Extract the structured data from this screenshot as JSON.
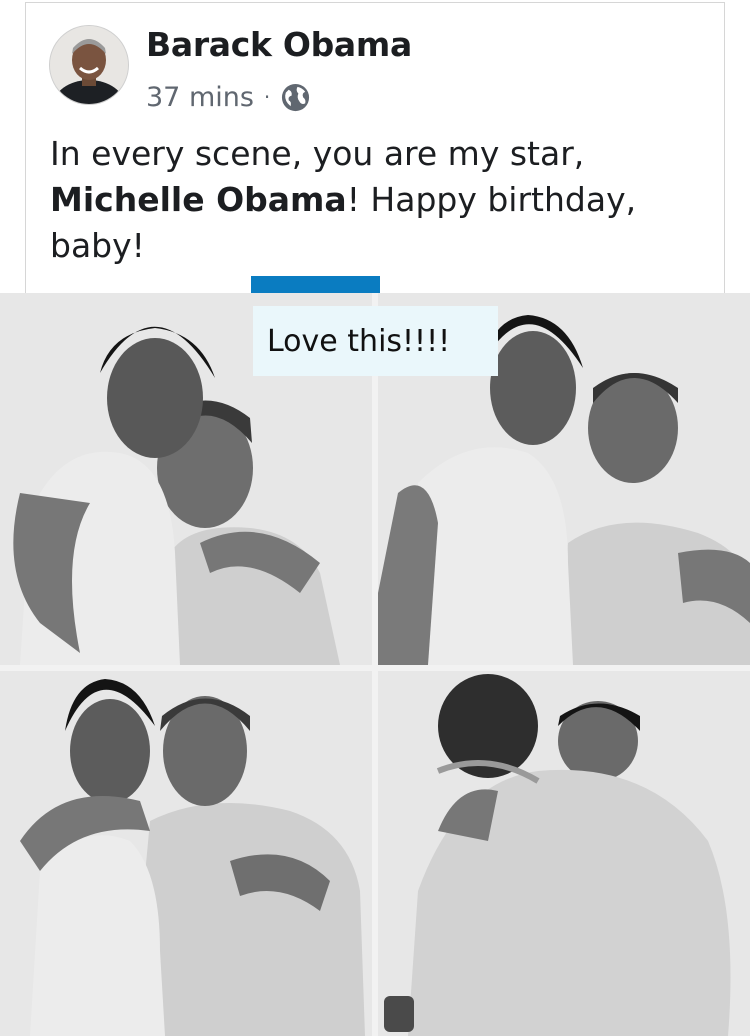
{
  "post": {
    "author": "Barack Obama",
    "time": "37 mins",
    "separator": "·",
    "privacy_icon": "globe-icon",
    "text_part1": "In every scene, you are my star, ",
    "mention": "Michelle Obama",
    "text_part2": "! Happy birthday, baby!"
  },
  "sticker": {
    "text": "Love this!!!!"
  },
  "colors": {
    "accent_tab": "#0a7cc1",
    "sticker_bg": "#eaf7fb",
    "name_text": "#1c1e21",
    "meta_text": "#606770"
  },
  "photos": [
    {
      "name": "photo-1"
    },
    {
      "name": "photo-2"
    },
    {
      "name": "photo-3"
    },
    {
      "name": "photo-4"
    }
  ]
}
